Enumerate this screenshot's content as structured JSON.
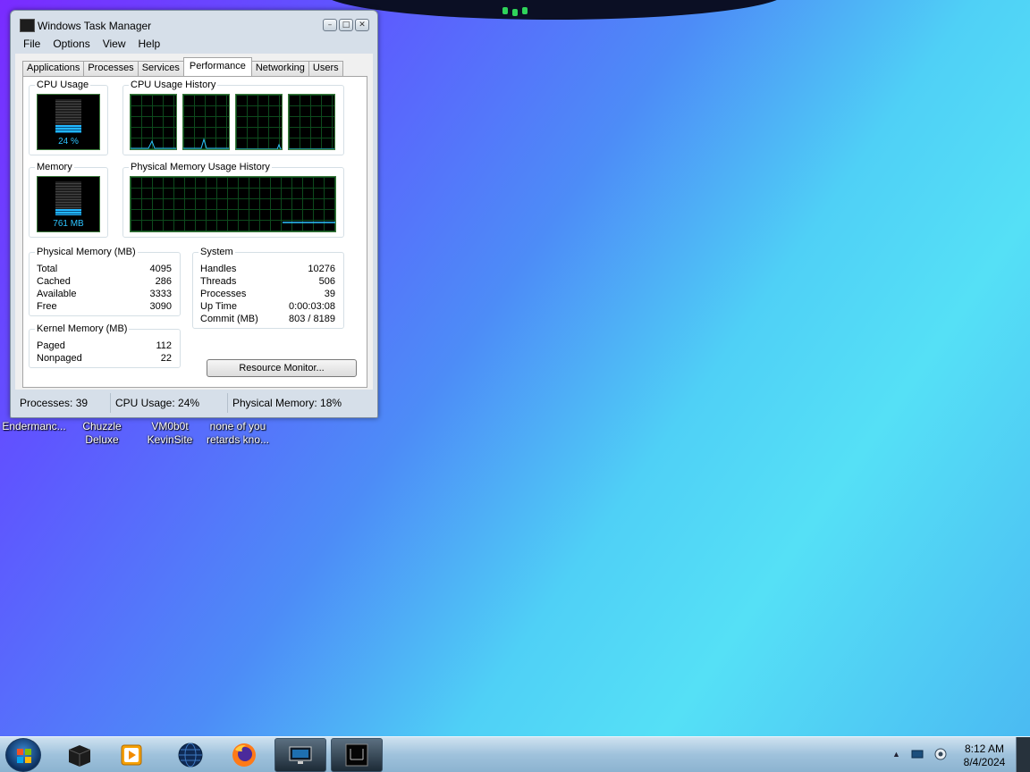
{
  "window": {
    "title": "Windows Task Manager",
    "menu": [
      "File",
      "Options",
      "View",
      "Help"
    ],
    "tabs": [
      "Applications",
      "Processes",
      "Services",
      "Performance",
      "Networking",
      "Users"
    ],
    "active_tab": "Performance"
  },
  "performance": {
    "cpu_usage_label": "CPU Usage",
    "cpu_usage_value": "24 %",
    "cpu_usage_fraction": 0.24,
    "cpu_history_label": "CPU Usage History",
    "memory_label": "Memory",
    "memory_value": "761 MB",
    "memory_fraction": 0.18,
    "phys_mem_history_label": "Physical Memory Usage History",
    "physical_memory": {
      "heading": "Physical Memory (MB)",
      "rows": [
        {
          "key": "Total",
          "value": "4095"
        },
        {
          "key": "Cached",
          "value": "286"
        },
        {
          "key": "Available",
          "value": "3333"
        },
        {
          "key": "Free",
          "value": "3090"
        }
      ]
    },
    "kernel_memory": {
      "heading": "Kernel Memory (MB)",
      "rows": [
        {
          "key": "Paged",
          "value": "112"
        },
        {
          "key": "Nonpaged",
          "value": "22"
        }
      ]
    },
    "system": {
      "heading": "System",
      "rows": [
        {
          "key": "Handles",
          "value": "10276"
        },
        {
          "key": "Threads",
          "value": "506"
        },
        {
          "key": "Processes",
          "value": "39"
        },
        {
          "key": "Up Time",
          "value": "0:00:03:08"
        },
        {
          "key": "Commit (MB)",
          "value": "803 / 8189"
        }
      ]
    },
    "resource_monitor_button": "Resource Monitor..."
  },
  "statusbar": {
    "processes": "Processes: 39",
    "cpu": "CPU Usage: 24%",
    "memory": "Physical Memory: 18%"
  },
  "desktop_icons": [
    {
      "line1": "Endermanc...",
      "line2": ""
    },
    {
      "line1": "Chuzzle",
      "line2": "Deluxe"
    },
    {
      "line1": "VM0b0t",
      "line2": "KevinSite"
    },
    {
      "line1": "none of you",
      "line2": "retards kno..."
    }
  ],
  "taskbar": {
    "clock_time": "8:12 AM",
    "clock_date": "8/4/2024"
  },
  "colors": {
    "graph_line": "#2dc3ff",
    "graph_grid": "#0d4a1d",
    "window_frame": "#d6dfe9"
  }
}
